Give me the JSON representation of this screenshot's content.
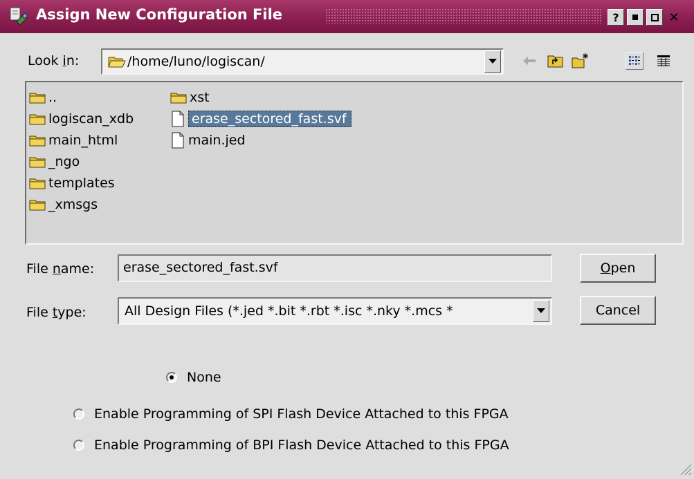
{
  "window": {
    "title": "Assign New Configuration File",
    "controls": {
      "help": "?",
      "minimize": "▪",
      "maximize": "□",
      "close": "✕"
    }
  },
  "look_in": {
    "label_pre": "Look ",
    "label_key": "i",
    "label_post": "n:",
    "path": "/home/luno/logiscan/"
  },
  "toolbar": {
    "icons": [
      "back-arrow-icon",
      "parent-folder-icon",
      "new-folder-icon",
      "list-view-icon",
      "detail-view-icon"
    ]
  },
  "files": {
    "column1": [
      {
        "name": "..",
        "type": "folder"
      },
      {
        "name": "logiscan_xdb",
        "type": "folder"
      },
      {
        "name": "main_html",
        "type": "folder"
      },
      {
        "name": "_ngo",
        "type": "folder"
      },
      {
        "name": "templates",
        "type": "folder"
      },
      {
        "name": "_xmsgs",
        "type": "folder"
      }
    ],
    "column2": [
      {
        "name": "xst",
        "type": "folder"
      },
      {
        "name": "erase_sectored_fast.svf",
        "type": "file",
        "selected": true
      },
      {
        "name": "main.jed",
        "type": "file"
      }
    ]
  },
  "file_name": {
    "label_pre": "File ",
    "label_key": "n",
    "label_post": "ame:",
    "value": "erase_sectored_fast.svf"
  },
  "file_type": {
    "label_pre": "File ",
    "label_key": "t",
    "label_post": "ype:",
    "value": "All Design Files (*.jed *.bit *.rbt *.isc *.nky *.mcs *"
  },
  "buttons": {
    "open_key": "O",
    "open_rest": "pen",
    "cancel": "Cancel"
  },
  "options": [
    {
      "label": "None",
      "checked": true
    },
    {
      "label": "Enable Programming of SPI Flash Device Attached to this FPGA",
      "checked": false
    },
    {
      "label": "Enable Programming of BPI Flash Device Attached to this FPGA",
      "checked": false
    }
  ]
}
